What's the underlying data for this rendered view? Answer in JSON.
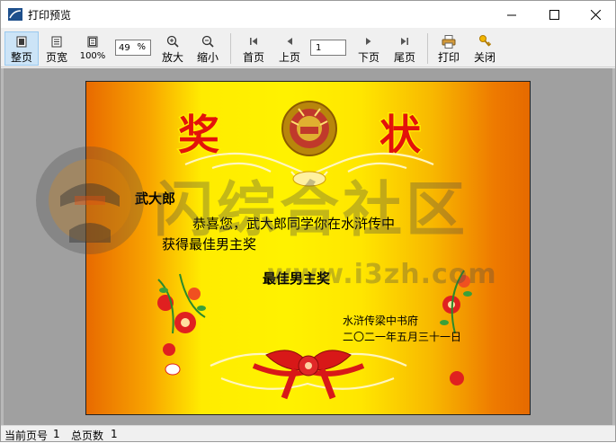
{
  "window": {
    "title": "打印预览",
    "controls": {
      "minimize": "minimize-icon",
      "maximize": "maximize-icon",
      "close": "close-icon"
    }
  },
  "toolbar": {
    "whole_page": "整页",
    "page_width": "页宽",
    "hundred": "100%",
    "zoom_value": "49",
    "zoom_unit": "%",
    "zoom_in": "放大",
    "zoom_out": "缩小",
    "first_page": "首页",
    "prev_page": "上页",
    "page_value": "1",
    "next_page": "下页",
    "last_page": "尾页",
    "print": "打印",
    "close": "关闭"
  },
  "certificate": {
    "title": "奖状",
    "recipient": "武大郎",
    "body_line1": "恭喜您，武大郎同学你在水浒传中",
    "body_line2": "获得最佳男主奖",
    "award": "最佳男主奖",
    "issuer": "水浒传梁中书府",
    "date": "二〇二一年五月三十一日"
  },
  "watermark": {
    "text": "闪综合社区",
    "url": "www.i3zh.com"
  },
  "status": {
    "current_page_label": "当前页号",
    "current_page": "1",
    "total_pages_label": "总页数",
    "total_pages": "1"
  },
  "colors": {
    "title_red": "#e3120b",
    "title_outline": "#ffe000",
    "ribbon_red": "#d81818",
    "active_button": "#cce4f7"
  }
}
